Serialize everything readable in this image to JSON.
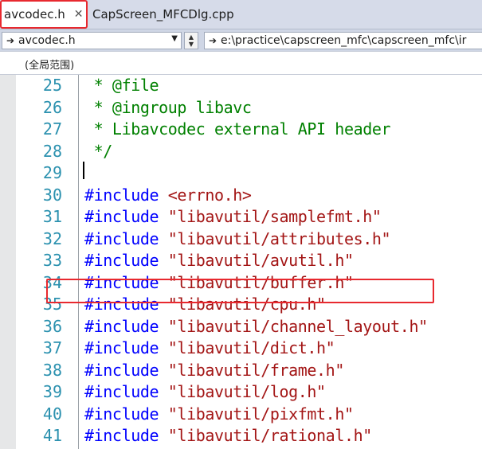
{
  "tabs": [
    {
      "label": "avcodec.h",
      "close": "✕",
      "active": true
    },
    {
      "label": "CapScreen_MFCDlg.cpp",
      "active": false
    }
  ],
  "navbar": {
    "file_combo": {
      "icon": "forward-arrow-icon",
      "value": "avcodec.h"
    },
    "path_combo": {
      "icon": "forward-arrow-icon",
      "value": "e:\\practice\\capscreen_mfc\\capscreen_mfc\\ir"
    }
  },
  "scope": {
    "label": "(全局范围)"
  },
  "editor": {
    "lines": [
      {
        "num": "25",
        "parts": [
          {
            "t": " * @file",
            "c": "cmt"
          }
        ]
      },
      {
        "num": "26",
        "parts": [
          {
            "t": " * @ingroup libavc",
            "c": "cmt"
          }
        ]
      },
      {
        "num": "27",
        "parts": [
          {
            "t": " * Libavcodec external API header",
            "c": "cmt"
          }
        ]
      },
      {
        "num": "28",
        "parts": [
          {
            "t": " */",
            "c": "cmt"
          }
        ]
      },
      {
        "num": "29",
        "parts": []
      },
      {
        "num": "30",
        "parts": [
          {
            "t": "#include ",
            "c": "kw"
          },
          {
            "t": "<errno.h>",
            "c": "str"
          }
        ]
      },
      {
        "num": "31",
        "parts": [
          {
            "t": "#include ",
            "c": "kw"
          },
          {
            "t": "\"libavutil/samplefmt.h\"",
            "c": "str"
          }
        ]
      },
      {
        "num": "32",
        "parts": [
          {
            "t": "#include ",
            "c": "kw"
          },
          {
            "t": "\"libavutil/attributes.h\"",
            "c": "str"
          }
        ]
      },
      {
        "num": "33",
        "parts": [
          {
            "t": "#include ",
            "c": "kw"
          },
          {
            "t": "\"libavutil/avutil.h\"",
            "c": "str"
          }
        ]
      },
      {
        "num": "34",
        "parts": [
          {
            "t": "#include ",
            "c": "kw"
          },
          {
            "t": "\"libavutil/buffer.h\"",
            "c": "str"
          }
        ]
      },
      {
        "num": "35",
        "parts": [
          {
            "t": "#include ",
            "c": "kw"
          },
          {
            "t": "\"libavutil/cpu.h\"",
            "c": "str"
          }
        ]
      },
      {
        "num": "36",
        "parts": [
          {
            "t": "#include ",
            "c": "kw"
          },
          {
            "t": "\"libavutil/channel_layout.h\"",
            "c": "str"
          }
        ]
      },
      {
        "num": "37",
        "parts": [
          {
            "t": "#include ",
            "c": "kw"
          },
          {
            "t": "\"libavutil/dict.h\"",
            "c": "str"
          }
        ]
      },
      {
        "num": "38",
        "parts": [
          {
            "t": "#include ",
            "c": "kw"
          },
          {
            "t": "\"libavutil/frame.h\"",
            "c": "str"
          }
        ]
      },
      {
        "num": "39",
        "parts": [
          {
            "t": "#include ",
            "c": "kw"
          },
          {
            "t": "\"libavutil/log.h\"",
            "c": "str"
          }
        ]
      },
      {
        "num": "40",
        "parts": [
          {
            "t": "#include ",
            "c": "kw"
          },
          {
            "t": "\"libavutil/pixfmt.h\"",
            "c": "str"
          }
        ]
      },
      {
        "num": "41",
        "parts": [
          {
            "t": "#include ",
            "c": "kw"
          },
          {
            "t": "\"libavutil/rational.h\"",
            "c": "str"
          }
        ]
      }
    ]
  },
  "colors": {
    "highlight": "#e8292f",
    "line_number": "#2b91af",
    "comment": "#008000",
    "keyword": "#0000ff",
    "string": "#a31515"
  }
}
